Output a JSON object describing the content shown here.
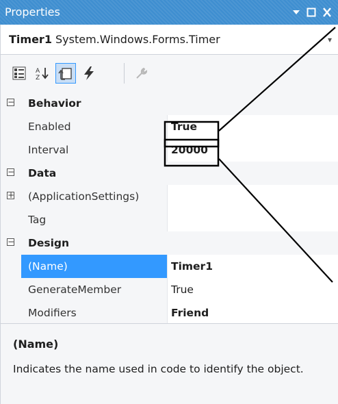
{
  "window": {
    "title": "Properties",
    "controls": {
      "dropdown_icon": "triangle-down-icon",
      "maximize_icon": "square-icon",
      "close_icon": "close-icon"
    }
  },
  "object_selector": {
    "name": "Timer1",
    "type": "System.Windows.Forms.Timer"
  },
  "toolbar": {
    "buttons": [
      "categorized-icon",
      "alphabetical-icon",
      "properties-icon",
      "events-icon",
      "property-pages-icon"
    ]
  },
  "grid": {
    "categories": [
      {
        "label": "Behavior",
        "collapsed": false
      },
      {
        "label": "Data",
        "collapsed": false
      },
      {
        "label": "Design",
        "collapsed": false
      }
    ],
    "properties": [
      {
        "label": "Enabled",
        "value": "True"
      },
      {
        "label": "Interval",
        "value": "20000"
      },
      {
        "label": "(ApplicationSettings)",
        "value": ""
      },
      {
        "label": "Tag",
        "value": ""
      },
      {
        "label": "(Name)",
        "value": "Timer1"
      },
      {
        "label": "GenerateMember",
        "value": "True"
      },
      {
        "label": "Modifiers",
        "value": "Friend"
      }
    ]
  },
  "description": {
    "title": "(Name)",
    "text": "Indicates the name used in code to identify the object."
  },
  "colors": {
    "title_bar": "#3e8ed0",
    "selection": "#3399ff",
    "panel_bg": "#f5f6f8"
  }
}
